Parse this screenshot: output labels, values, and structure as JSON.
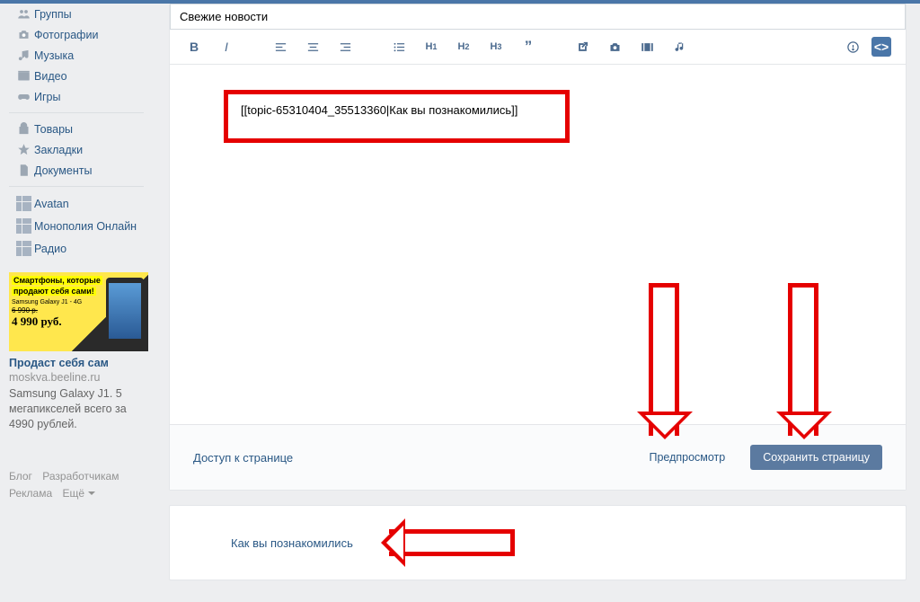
{
  "sidebar": {
    "groups": "Группы",
    "photos": "Фотографии",
    "music": "Музыка",
    "videos": "Видео",
    "games": "Игры",
    "market": "Товары",
    "bookmarks": "Закладки",
    "documents": "Документы",
    "avatan": "Avatan",
    "monopoly": "Монополия Онлайн",
    "radio": "Радио"
  },
  "ad": {
    "line1": "Смартфоны, которые",
    "line2": "продают себя сами!",
    "model": "Samsung Galaxy J1 - 4G",
    "old": "6 990 р.",
    "price": "4 990 руб.",
    "title": "Продаст себя сам",
    "sub": "moskva.beeline.ru",
    "desc": "Samsung Galaxy J1. 5 мегапикселей всего за 4990 рублей."
  },
  "footer": {
    "blog": "Блог",
    "dev": "Разработчикам",
    "adv": "Реклама",
    "more": "Ещё"
  },
  "editor": {
    "title_value": "Свежие новости",
    "code_text": "[[topic-65310404_35513360|Как вы познакомились]]"
  },
  "actions": {
    "access": "Доступ к странице",
    "preview": "Предпросмотр",
    "save": "Сохранить страницу"
  },
  "result_link": "Как вы познакомились"
}
